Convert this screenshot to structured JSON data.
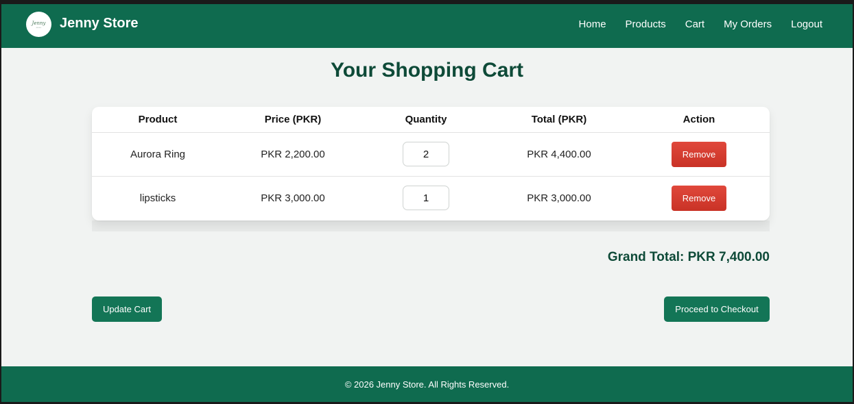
{
  "brand": {
    "name": "Jenny Store",
    "logo_text": "Jenny"
  },
  "nav": {
    "items": [
      {
        "label": "Home"
      },
      {
        "label": "Products"
      },
      {
        "label": "Cart"
      },
      {
        "label": "My Orders"
      },
      {
        "label": "Logout"
      }
    ]
  },
  "page": {
    "title": "Your Shopping Cart"
  },
  "cart": {
    "headers": [
      "Product",
      "Price (PKR)",
      "Quantity",
      "Total (PKR)",
      "Action"
    ],
    "rows": [
      {
        "product": "Aurora Ring",
        "price": "PKR 2,200.00",
        "quantity": "2",
        "total": "PKR 4,400.00",
        "action": "Remove"
      },
      {
        "product": "lipsticks",
        "price": "PKR 3,000.00",
        "quantity": "1",
        "total": "PKR 3,000.00",
        "action": "Remove"
      }
    ],
    "grand_total": "Grand Total: PKR 7,400.00"
  },
  "buttons": {
    "update": "Update Cart",
    "checkout": "Proceed to Checkout"
  },
  "footer": {
    "text": "© 2026 Jenny Store. All Rights Reserved."
  },
  "colors": {
    "primary": "#0f6b4f",
    "title": "#0e4a38",
    "danger": "#d63c30",
    "background": "#f1f3f2"
  }
}
